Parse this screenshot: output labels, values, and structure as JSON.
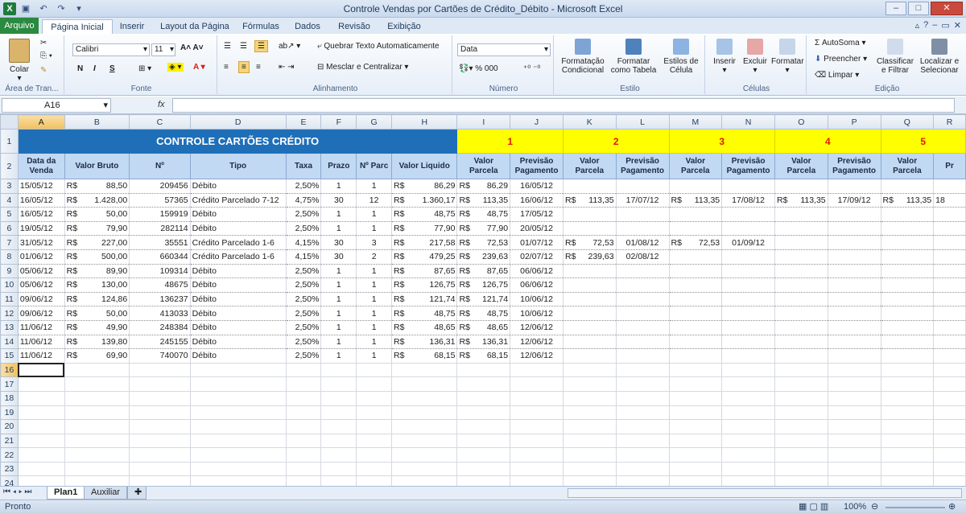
{
  "window": {
    "title": "Controle Vendas por Cartões de Crédito_Débito  -  Microsoft Excel"
  },
  "ribbon_tabs": [
    "Arquivo",
    "Página Inicial",
    "Inserir",
    "Layout da Página",
    "Fórmulas",
    "Dados",
    "Revisão",
    "Exibição"
  ],
  "clipboard": {
    "paste": "Colar",
    "group": "Área de Tran..."
  },
  "font": {
    "name": "Calibri",
    "size": "11",
    "bold": "N",
    "italic": "I",
    "underline": "S",
    "group": "Fonte"
  },
  "alignment": {
    "wrap": "Quebrar Texto Automaticamente",
    "merge": "Mesclar e Centralizar",
    "group": "Alinhamento"
  },
  "number": {
    "format": "Data",
    "group": "Número"
  },
  "styles": {
    "cond": "Formatação Condicional",
    "table": "Formatar como Tabela",
    "cell": "Estilos de Célula",
    "group": "Estilo"
  },
  "cells": {
    "insert": "Inserir",
    "delete": "Excluir",
    "format": "Formatar",
    "group": "Células"
  },
  "editing": {
    "autosum": "AutoSoma",
    "fill": "Preencher",
    "clear": "Limpar",
    "sort": "Classificar e Filtrar",
    "find": "Localizar e Selecionar",
    "group": "Edição"
  },
  "formula_bar": {
    "name_box": "A16",
    "fx": "fx",
    "value": ""
  },
  "colors": {
    "title_bg": "#1f6fb8",
    "yellow": "#ffff00",
    "header_bg": "#c2d9f3",
    "red": "#e3160b"
  },
  "columns": [
    "A",
    "B",
    "C",
    "D",
    "E",
    "F",
    "G",
    "H",
    "I",
    "J",
    "K",
    "L",
    "M",
    "N",
    "O",
    "P",
    "Q",
    "R"
  ],
  "sheet_title": "CONTROLE CARTÕES CRÉDITO",
  "installments": [
    "1",
    "2",
    "3",
    "4",
    "5"
  ],
  "headers": [
    "Data da Venda",
    "Valor Bruto",
    "Nº",
    "Tipo",
    "Taxa",
    "Prazo",
    "Nº Parc",
    "Valor Liquido",
    "Valor Parcela",
    "Previsão Pagamento",
    "Valor Parcela",
    "Previsão Pagamento",
    "Valor Parcela",
    "Previsão Pagamento",
    "Valor Parcela",
    "Previsão Pagamento",
    "Valor Parcela",
    "Pr"
  ],
  "rows": [
    [
      "15/05/12",
      "88,50",
      "209456",
      "Débito",
      "2,50%",
      "1",
      "1",
      "86,29",
      "86,29",
      "16/05/12",
      "",
      "",
      "",
      "",
      "",
      "",
      "",
      ""
    ],
    [
      "16/05/12",
      "1.428,00",
      "57365",
      "Crédito Parcelado 7-12",
      "4,75%",
      "30",
      "12",
      "1.360,17",
      "113,35",
      "16/06/12",
      "113,35",
      "17/07/12",
      "113,35",
      "17/08/12",
      "113,35",
      "17/09/12",
      "113,35",
      "18"
    ],
    [
      "16/05/12",
      "50,00",
      "159919",
      "Débito",
      "2,50%",
      "1",
      "1",
      "48,75",
      "48,75",
      "17/05/12",
      "",
      "",
      "",
      "",
      "",
      "",
      "",
      ""
    ],
    [
      "19/05/12",
      "79,90",
      "282114",
      "Débito",
      "2,50%",
      "1",
      "1",
      "77,90",
      "77,90",
      "20/05/12",
      "",
      "",
      "",
      "",
      "",
      "",
      "",
      ""
    ],
    [
      "31/05/12",
      "227,00",
      "35551",
      "Crédito Parcelado 1-6",
      "4,15%",
      "30",
      "3",
      "217,58",
      "72,53",
      "01/07/12",
      "72,53",
      "01/08/12",
      "72,53",
      "01/09/12",
      "",
      "",
      "",
      ""
    ],
    [
      "01/06/12",
      "500,00",
      "660344",
      "Crédito Parcelado 1-6",
      "4,15%",
      "30",
      "2",
      "479,25",
      "239,63",
      "02/07/12",
      "239,63",
      "02/08/12",
      "",
      "",
      "",
      "",
      "",
      ""
    ],
    [
      "05/06/12",
      "89,90",
      "109314",
      "Débito",
      "2,50%",
      "1",
      "1",
      "87,65",
      "87,65",
      "06/06/12",
      "",
      "",
      "",
      "",
      "",
      "",
      "",
      ""
    ],
    [
      "05/06/12",
      "130,00",
      "48675",
      "Débito",
      "2,50%",
      "1",
      "1",
      "126,75",
      "126,75",
      "06/06/12",
      "",
      "",
      "",
      "",
      "",
      "",
      "",
      ""
    ],
    [
      "09/06/12",
      "124,86",
      "136237",
      "Débito",
      "2,50%",
      "1",
      "1",
      "121,74",
      "121,74",
      "10/06/12",
      "",
      "",
      "",
      "",
      "",
      "",
      "",
      ""
    ],
    [
      "09/06/12",
      "50,00",
      "413033",
      "Débito",
      "2,50%",
      "1",
      "1",
      "48,75",
      "48,75",
      "10/06/12",
      "",
      "",
      "",
      "",
      "",
      "",
      "",
      ""
    ],
    [
      "11/06/12",
      "49,90",
      "248384",
      "Débito",
      "2,50%",
      "1",
      "1",
      "48,65",
      "48,65",
      "12/06/12",
      "",
      "",
      "",
      "",
      "",
      "",
      "",
      ""
    ],
    [
      "11/06/12",
      "139,80",
      "245155",
      "Débito",
      "2,50%",
      "1",
      "1",
      "136,31",
      "136,31",
      "12/06/12",
      "",
      "",
      "",
      "",
      "",
      "",
      "",
      ""
    ],
    [
      "11/06/12",
      "69,90",
      "740070",
      "Débito",
      "2,50%",
      "1",
      "1",
      "68,15",
      "68,15",
      "12/06/12",
      "",
      "",
      "",
      "",
      "",
      "",
      "",
      ""
    ]
  ],
  "currency": "R$",
  "sheets": [
    "Plan1",
    "Auxiliar"
  ],
  "status": {
    "ready": "Pronto",
    "zoom": "100%"
  }
}
